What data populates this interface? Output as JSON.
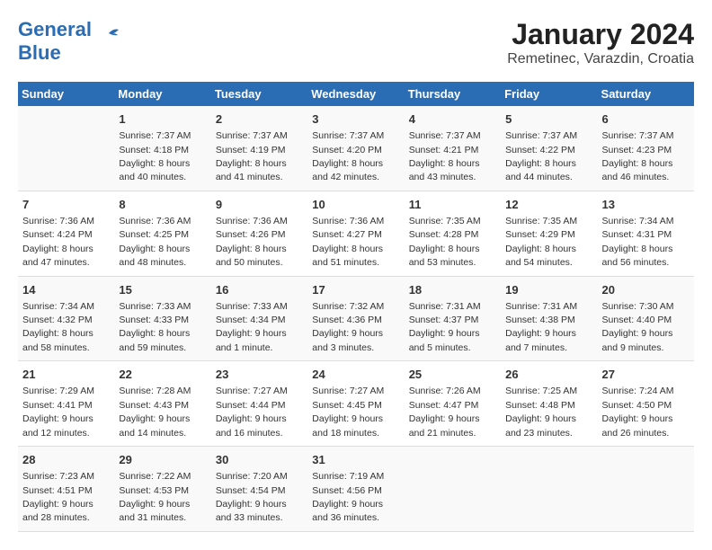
{
  "header": {
    "logo_general": "General",
    "logo_blue": "Blue",
    "title": "January 2024",
    "subtitle": "Remetinec, Varazdin, Croatia"
  },
  "days_of_week": [
    "Sunday",
    "Monday",
    "Tuesday",
    "Wednesday",
    "Thursday",
    "Friday",
    "Saturday"
  ],
  "weeks": [
    [
      {
        "day": "",
        "sunrise": "",
        "sunset": "",
        "daylight": ""
      },
      {
        "day": "1",
        "sunrise": "7:37 AM",
        "sunset": "4:18 PM",
        "daylight": "8 hours and 40 minutes."
      },
      {
        "day": "2",
        "sunrise": "7:37 AM",
        "sunset": "4:19 PM",
        "daylight": "8 hours and 41 minutes."
      },
      {
        "day": "3",
        "sunrise": "7:37 AM",
        "sunset": "4:20 PM",
        "daylight": "8 hours and 42 minutes."
      },
      {
        "day": "4",
        "sunrise": "7:37 AM",
        "sunset": "4:21 PM",
        "daylight": "8 hours and 43 minutes."
      },
      {
        "day": "5",
        "sunrise": "7:37 AM",
        "sunset": "4:22 PM",
        "daylight": "8 hours and 44 minutes."
      },
      {
        "day": "6",
        "sunrise": "7:37 AM",
        "sunset": "4:23 PM",
        "daylight": "8 hours and 46 minutes."
      }
    ],
    [
      {
        "day": "7",
        "sunrise": "7:36 AM",
        "sunset": "4:24 PM",
        "daylight": "8 hours and 47 minutes."
      },
      {
        "day": "8",
        "sunrise": "7:36 AM",
        "sunset": "4:25 PM",
        "daylight": "8 hours and 48 minutes."
      },
      {
        "day": "9",
        "sunrise": "7:36 AM",
        "sunset": "4:26 PM",
        "daylight": "8 hours and 50 minutes."
      },
      {
        "day": "10",
        "sunrise": "7:36 AM",
        "sunset": "4:27 PM",
        "daylight": "8 hours and 51 minutes."
      },
      {
        "day": "11",
        "sunrise": "7:35 AM",
        "sunset": "4:28 PM",
        "daylight": "8 hours and 53 minutes."
      },
      {
        "day": "12",
        "sunrise": "7:35 AM",
        "sunset": "4:29 PM",
        "daylight": "8 hours and 54 minutes."
      },
      {
        "day": "13",
        "sunrise": "7:34 AM",
        "sunset": "4:31 PM",
        "daylight": "8 hours and 56 minutes."
      }
    ],
    [
      {
        "day": "14",
        "sunrise": "7:34 AM",
        "sunset": "4:32 PM",
        "daylight": "8 hours and 58 minutes."
      },
      {
        "day": "15",
        "sunrise": "7:33 AM",
        "sunset": "4:33 PM",
        "daylight": "8 hours and 59 minutes."
      },
      {
        "day": "16",
        "sunrise": "7:33 AM",
        "sunset": "4:34 PM",
        "daylight": "9 hours and 1 minute."
      },
      {
        "day": "17",
        "sunrise": "7:32 AM",
        "sunset": "4:36 PM",
        "daylight": "9 hours and 3 minutes."
      },
      {
        "day": "18",
        "sunrise": "7:31 AM",
        "sunset": "4:37 PM",
        "daylight": "9 hours and 5 minutes."
      },
      {
        "day": "19",
        "sunrise": "7:31 AM",
        "sunset": "4:38 PM",
        "daylight": "9 hours and 7 minutes."
      },
      {
        "day": "20",
        "sunrise": "7:30 AM",
        "sunset": "4:40 PM",
        "daylight": "9 hours and 9 minutes."
      }
    ],
    [
      {
        "day": "21",
        "sunrise": "7:29 AM",
        "sunset": "4:41 PM",
        "daylight": "9 hours and 12 minutes."
      },
      {
        "day": "22",
        "sunrise": "7:28 AM",
        "sunset": "4:43 PM",
        "daylight": "9 hours and 14 minutes."
      },
      {
        "day": "23",
        "sunrise": "7:27 AM",
        "sunset": "4:44 PM",
        "daylight": "9 hours and 16 minutes."
      },
      {
        "day": "24",
        "sunrise": "7:27 AM",
        "sunset": "4:45 PM",
        "daylight": "9 hours and 18 minutes."
      },
      {
        "day": "25",
        "sunrise": "7:26 AM",
        "sunset": "4:47 PM",
        "daylight": "9 hours and 21 minutes."
      },
      {
        "day": "26",
        "sunrise": "7:25 AM",
        "sunset": "4:48 PM",
        "daylight": "9 hours and 23 minutes."
      },
      {
        "day": "27",
        "sunrise": "7:24 AM",
        "sunset": "4:50 PM",
        "daylight": "9 hours and 26 minutes."
      }
    ],
    [
      {
        "day": "28",
        "sunrise": "7:23 AM",
        "sunset": "4:51 PM",
        "daylight": "9 hours and 28 minutes."
      },
      {
        "day": "29",
        "sunrise": "7:22 AM",
        "sunset": "4:53 PM",
        "daylight": "9 hours and 31 minutes."
      },
      {
        "day": "30",
        "sunrise": "7:20 AM",
        "sunset": "4:54 PM",
        "daylight": "9 hours and 33 minutes."
      },
      {
        "day": "31",
        "sunrise": "7:19 AM",
        "sunset": "4:56 PM",
        "daylight": "9 hours and 36 minutes."
      },
      {
        "day": "",
        "sunrise": "",
        "sunset": "",
        "daylight": ""
      },
      {
        "day": "",
        "sunrise": "",
        "sunset": "",
        "daylight": ""
      },
      {
        "day": "",
        "sunrise": "",
        "sunset": "",
        "daylight": ""
      }
    ]
  ]
}
